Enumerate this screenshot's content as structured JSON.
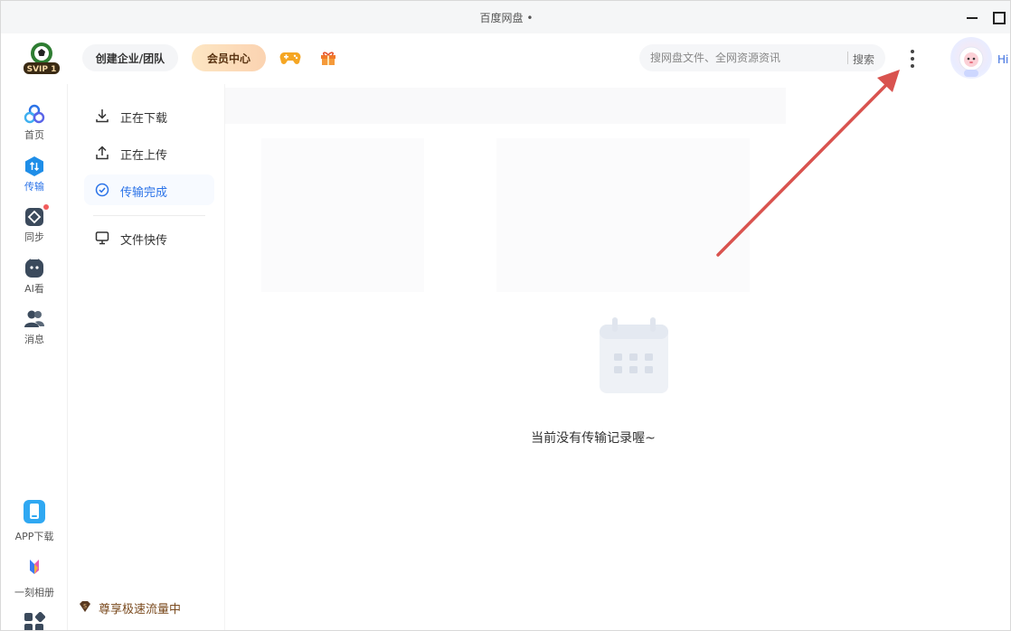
{
  "window": {
    "title": "百度网盘 •"
  },
  "header": {
    "logo_text": "SVIP 1",
    "team_label": "创建企业/团队",
    "vip_label": "会员中心",
    "search": {
      "placeholder": "搜网盘文件、全网资源资讯",
      "button_label": "搜索"
    },
    "greeting": "Hi"
  },
  "sidebar": {
    "items": [
      {
        "label": "首页",
        "icon": "home-icon"
      },
      {
        "label": "传输",
        "icon": "transfer-icon"
      },
      {
        "label": "同步",
        "icon": "sync-icon"
      },
      {
        "label": "AI看",
        "icon": "ai-view-icon"
      },
      {
        "label": "消息",
        "icon": "message-icon"
      }
    ],
    "bottom_items": [
      {
        "label": "APP下载",
        "icon": "phone-icon"
      },
      {
        "label": "一刻相册",
        "icon": "album-icon"
      }
    ],
    "active": "传输"
  },
  "transfer_menu": {
    "items": [
      {
        "label": "正在下载",
        "icon": "download-icon"
      },
      {
        "label": "正在上传",
        "icon": "upload-icon"
      },
      {
        "label": "传输完成",
        "icon": "check-circle-icon"
      },
      {
        "label": "文件快传",
        "icon": "monitor-icon"
      }
    ],
    "active": "传输完成",
    "speed_label": "尊享极速流量中"
  },
  "main": {
    "empty_text": "当前没有传输记录喔~"
  },
  "colors": {
    "accent": "#2b73e8",
    "annotation_arrow": "#d9534f",
    "vip_gold": "#fbd3b1"
  }
}
